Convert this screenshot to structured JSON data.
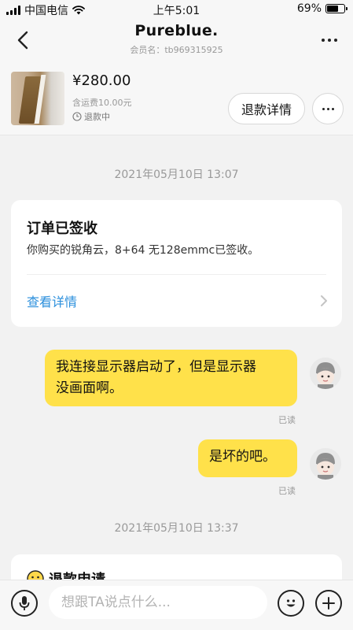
{
  "status_bar": {
    "carrier": "中国电信",
    "time": "上午5:01",
    "battery": "69%",
    "battery_level": 0.69
  },
  "nav": {
    "title": "Pureblue.",
    "member": "会员名：tb969315925"
  },
  "product": {
    "price": "¥280.00",
    "shipping": "含运费10.00元",
    "status": "退款中",
    "refund_detail_label": "退款详情"
  },
  "chat": {
    "timestamp_1": "2021年05月10日 13:07",
    "order_card": {
      "title": "订单已签收",
      "body": "你购买的锐角云，8+64 无128emmc已签收。",
      "link": "查看详情"
    },
    "message_1_line_1": "我连接显示器启动了，但是显示器",
    "message_1_line_2": "没画面啊。",
    "message_1_read": "已读",
    "message_2": "是坏的吧。",
    "message_2_read": "已读",
    "timestamp_2": "2021年05月10日 13:37",
    "refund_card_title": "退款申请"
  },
  "input": {
    "placeholder": "想跟TA说点什么..."
  },
  "colors": {
    "bubble": "#ffe14a",
    "link": "#2b8fdc",
    "background": "#f2f2f2"
  }
}
